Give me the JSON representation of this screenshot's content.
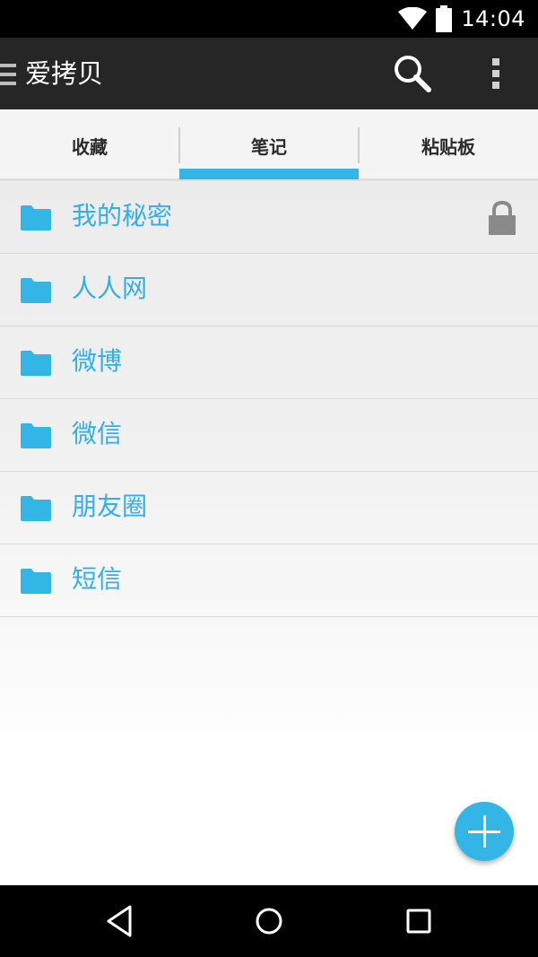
{
  "status_bar": {
    "time": "14:04",
    "icons": [
      "wifi-icon",
      "battery-icon"
    ]
  },
  "toolbar": {
    "title": "爱拷贝",
    "icons": [
      "menu-icon",
      "search-icon",
      "more-vert-icon"
    ]
  },
  "tabs": [
    {
      "label": "收藏",
      "selected": false
    },
    {
      "label": "笔记",
      "selected": true
    },
    {
      "label": "粘贴板",
      "selected": false
    }
  ],
  "folders": [
    {
      "label": "我的秘密",
      "locked": true
    },
    {
      "label": "人人网",
      "locked": false
    },
    {
      "label": "微博",
      "locked": false
    },
    {
      "label": "微信",
      "locked": false
    },
    {
      "label": "朋友圈",
      "locked": false
    },
    {
      "label": "短信",
      "locked": false
    }
  ],
  "fab": {
    "icon": "add-icon"
  },
  "nav_bar": {
    "icons": [
      "back-icon",
      "home-icon",
      "recents-icon"
    ]
  },
  "colors": {
    "accent": "#33b5e5",
    "folder_text": "#33aee6",
    "toolbar_bg": "#262626"
  }
}
